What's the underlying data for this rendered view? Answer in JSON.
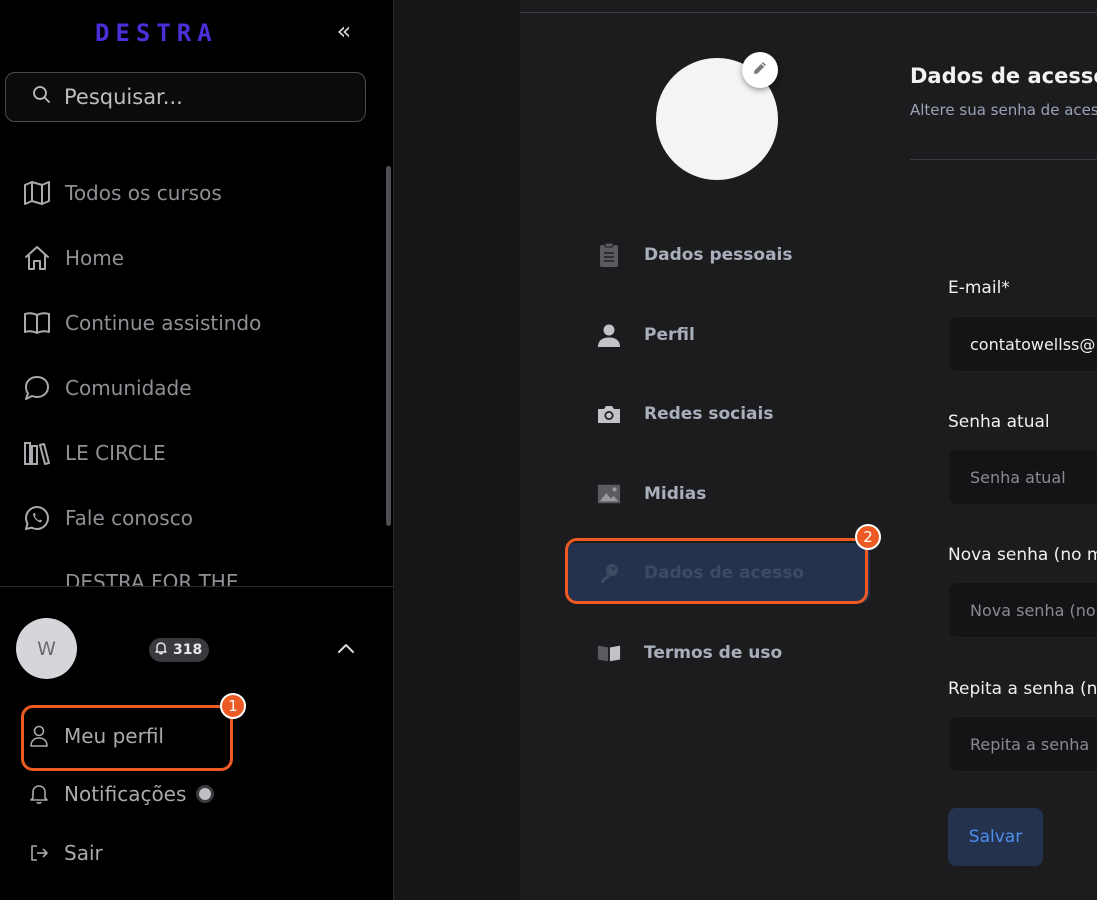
{
  "sidebar": {
    "logo": "DESTRA",
    "collapse_label": "«",
    "search": {
      "placeholder": "Pesquisar..."
    },
    "nav": [
      {
        "label": "Todos os cursos",
        "icon": "map-icon"
      },
      {
        "label": "Home",
        "icon": "home-icon"
      },
      {
        "label": "Continue assistindo",
        "icon": "book-open-icon"
      },
      {
        "label": "Comunidade",
        "icon": "chat-bubble-icon"
      },
      {
        "label": "LE CIRCLE",
        "icon": "library-icon"
      },
      {
        "label": "Fale conosco",
        "icon": "whatsapp-icon"
      }
    ],
    "nav_cut_label": "DESTRA FOR THE",
    "user": {
      "avatar_letter": "W",
      "notification_count": "318"
    },
    "menu": [
      {
        "label": "Meu perfil",
        "icon": "user-icon"
      },
      {
        "label": "Notificações",
        "icon": "bell-icon"
      },
      {
        "label": "Sair",
        "icon": "logout-icon"
      }
    ]
  },
  "annotations": {
    "marker_1": "1",
    "marker_2": "2",
    "color": "#ee5a24"
  },
  "settings_nav": [
    {
      "label": "Dados pessoais",
      "icon": "clipboard-icon"
    },
    {
      "label": "Perfil",
      "icon": "person-icon"
    },
    {
      "label": "Redes sociais",
      "icon": "camera-icon"
    },
    {
      "label": "Midias",
      "icon": "image-icon"
    },
    {
      "label": "Dados de acesso",
      "icon": "key-icon",
      "active": true
    },
    {
      "label": "Termos de uso",
      "icon": "open-book-icon"
    }
  ],
  "section": {
    "title": "Dados de acesso",
    "subtitle": "Altere sua senha de acesso"
  },
  "form": {
    "email": {
      "label": "E-mail*",
      "value": "contatowellss@"
    },
    "current_password": {
      "label": "Senha atual",
      "placeholder": "Senha atual"
    },
    "new_password": {
      "label": "Nova senha (no m",
      "placeholder": "Nova senha (no"
    },
    "repeat_password": {
      "label": "Repita a senha (no",
      "placeholder": "Repita a senha"
    },
    "save_label": "Salvar"
  },
  "colors": {
    "accent": "#4d8ff0",
    "logo": "#4b2fd8",
    "active_bg": "#25324d"
  }
}
